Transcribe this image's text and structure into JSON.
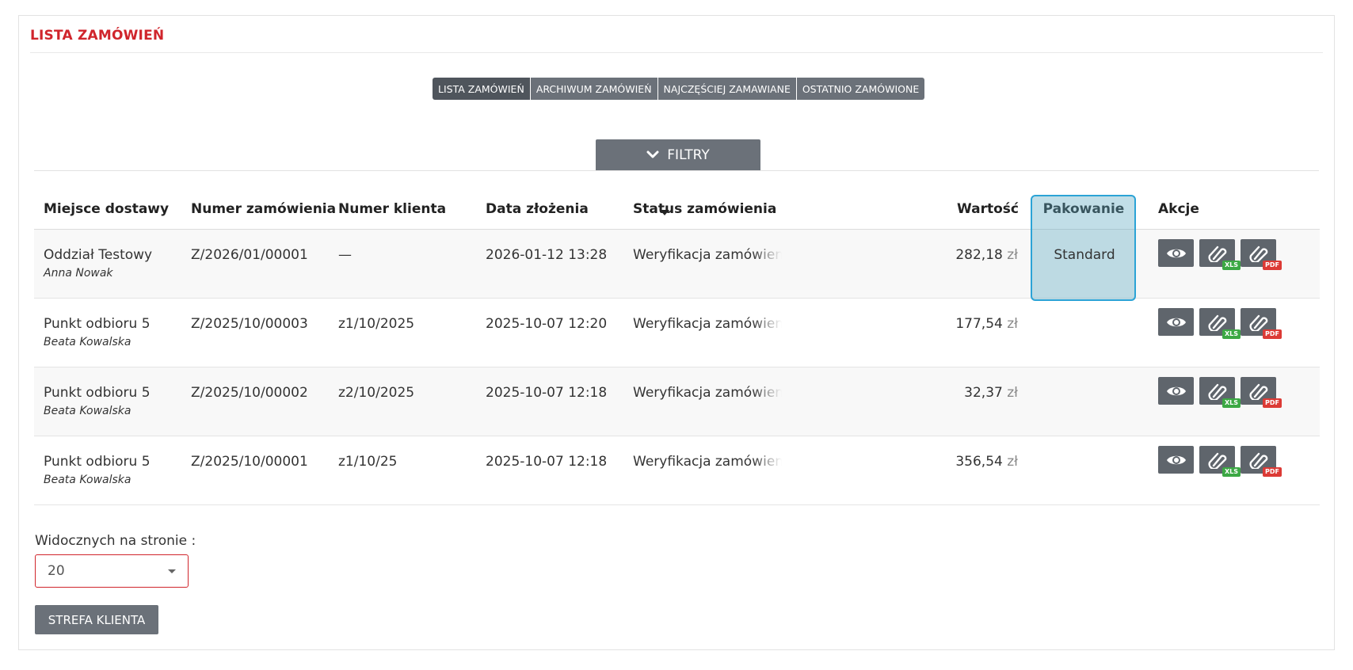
{
  "page": {
    "title": "LISTA ZAMÓWIEŃ",
    "accent_color": "#d0252c"
  },
  "tabs": [
    {
      "label": "LISTA ZAMÓWIEŃ",
      "active": true
    },
    {
      "label": "ARCHIWUM ZAMÓWIEŃ",
      "active": false
    },
    {
      "label": "NAJCZĘŚCIEJ ZAMAWIANE",
      "active": false
    },
    {
      "label": "OSTATNIO ZAMÓWIONE",
      "active": false
    }
  ],
  "filters": {
    "label": "FILTRY",
    "icon": "chevron-down-icon"
  },
  "table": {
    "columns": {
      "delivery": "Miejsce dostawy",
      "order_number": "Numer zamówienia",
      "client_number": "Numer klienta",
      "date": "Data złożenia",
      "status": "Status zamówienia",
      "value": "Wartość",
      "packing": "Pakowanie",
      "actions": "Akcje"
    },
    "sort": {
      "column": "date",
      "direction": "desc",
      "icon": "sort-down-icon"
    },
    "rows": [
      {
        "delivery": "Oddział Testowy",
        "person": "Anna Nowak",
        "order_number": "Z/2026/01/00001",
        "client_number": "—",
        "date": "2026-01-12 13:28",
        "status": "Weryfikacja zamówienia",
        "value": "282,18",
        "currency": "zł",
        "packing": "Standard"
      },
      {
        "delivery": "Punkt odbioru 5",
        "person": "Beata Kowalska",
        "order_number": "Z/2025/10/00003",
        "client_number": "z1/10/2025",
        "date": "2025-10-07 12:20",
        "status": "Weryfikacja zamówienia",
        "value": "177,54",
        "currency": "zł",
        "packing": ""
      },
      {
        "delivery": "Punkt odbioru 5",
        "person": "Beata Kowalska",
        "order_number": "Z/2025/10/00002",
        "client_number": "z2/10/2025",
        "date": "2025-10-07 12:18",
        "status": "Weryfikacja zamówienia",
        "value": "32,37",
        "currency": "zł",
        "packing": ""
      },
      {
        "delivery": "Punkt odbioru 5",
        "person": "Beata Kowalska",
        "order_number": "Z/2025/10/00001",
        "client_number": "z1/10/25",
        "date": "2025-10-07 12:18",
        "status": "Weryfikacja zamówienia",
        "value": "356,54",
        "currency": "zł",
        "packing": ""
      }
    ],
    "action_badges": {
      "xls": "XLS",
      "pdf": "PDF"
    },
    "action_icons": [
      "eye-icon",
      "paperclip-icon",
      "paperclip-icon"
    ]
  },
  "pagination": {
    "label": "Widocznych na stronie :",
    "selected": "20"
  },
  "footer": {
    "client_zone_button": "STREFA KLIENTA"
  }
}
